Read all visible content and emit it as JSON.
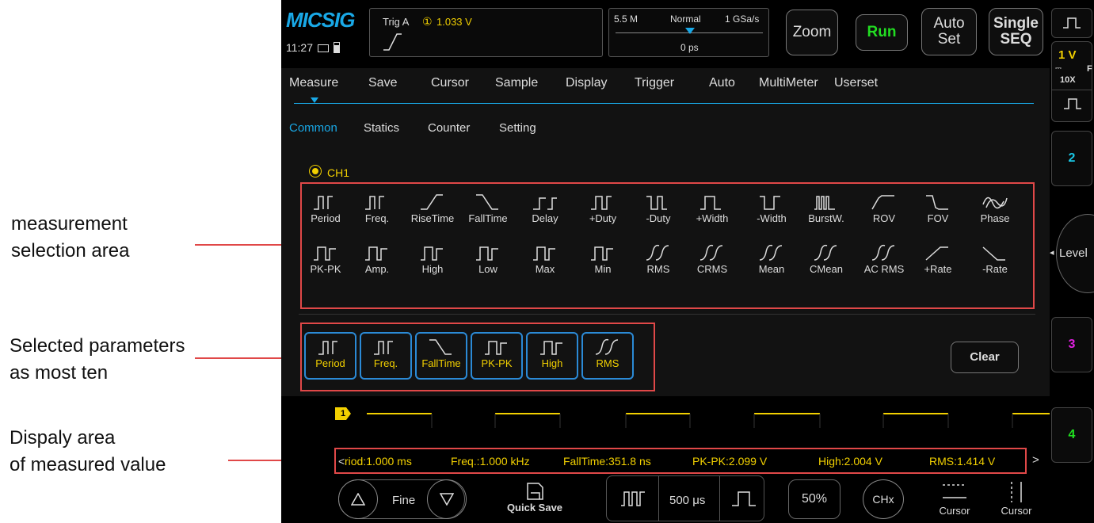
{
  "annotations": {
    "measurement_area": [
      "measurement",
      "selection area"
    ],
    "selected_params": [
      "Selected parameters",
      "as most ten"
    ],
    "display_area": [
      "Dispaly area",
      "of measured value"
    ]
  },
  "status": {
    "logo": "MICSIG",
    "time": "11:27",
    "trig_label": "Trig A",
    "trig_channel": "①",
    "trig_level": "1.033 V",
    "memory_depth": "5.5 M",
    "acq_mode": "Normal",
    "sample_rate": "1 GSa/s",
    "time_offset": "0 ps"
  },
  "top_buttons": {
    "zoom": "Zoom",
    "run": "Run",
    "auto_set": [
      "Auto",
      "Set"
    ],
    "single_seq": [
      "Single",
      "SEQ"
    ]
  },
  "menu": {
    "tabs": [
      "Measure",
      "Save",
      "Cursor",
      "Sample",
      "Display",
      "Trigger",
      "Auto",
      "MultiMeter",
      "Userset"
    ],
    "subtabs": [
      "Common",
      "Statics",
      "Counter",
      "Setting"
    ],
    "channel": "CH1"
  },
  "measurements_row1": [
    "Period",
    "Freq.",
    "RiseTime",
    "FallTime",
    "Delay",
    "+Duty",
    "-Duty",
    "+Width",
    "-Width",
    "BurstW.",
    "ROV",
    "FOV",
    "Phase"
  ],
  "measurements_row2": [
    "PK-PK",
    "Amp.",
    "High",
    "Low",
    "Max",
    "Min",
    "RMS",
    "CRMS",
    "Mean",
    "CMean",
    "AC RMS",
    "+Rate",
    "-Rate"
  ],
  "selected": [
    "Period",
    "Freq.",
    "FallTime",
    "PK-PK",
    "High",
    "RMS"
  ],
  "clear_label": "Clear",
  "waveform": {
    "channel_marker": "1"
  },
  "results": {
    "prev": "<",
    "items": [
      "riod:1.000 ms",
      "Freq.:1.000 kHz",
      "FallTime:351.8 ns",
      "PK-PK:2.099 V",
      "High:2.004 V",
      "RMS:1.414 V"
    ],
    "next": ">"
  },
  "bottom": {
    "fine": "Fine",
    "quick_save": "Quick Save",
    "timebase": "500 μs",
    "percent": "50%",
    "chx": "CHx",
    "cursor1": "Cursor",
    "cursor2": "Cursor"
  },
  "side": {
    "ch1_scale": "1 V",
    "ch1_probe": "10X",
    "ch1_coupling": "F",
    "ch2": "2",
    "level": "Level",
    "ch3": "3",
    "ch4": "4"
  },
  "colors": {
    "ch1": "#f2d000",
    "ch2": "#19c8e6",
    "ch3": "#e020e0",
    "ch4": "#20e020",
    "accent": "#19a8e6",
    "run": "#22dd22"
  }
}
